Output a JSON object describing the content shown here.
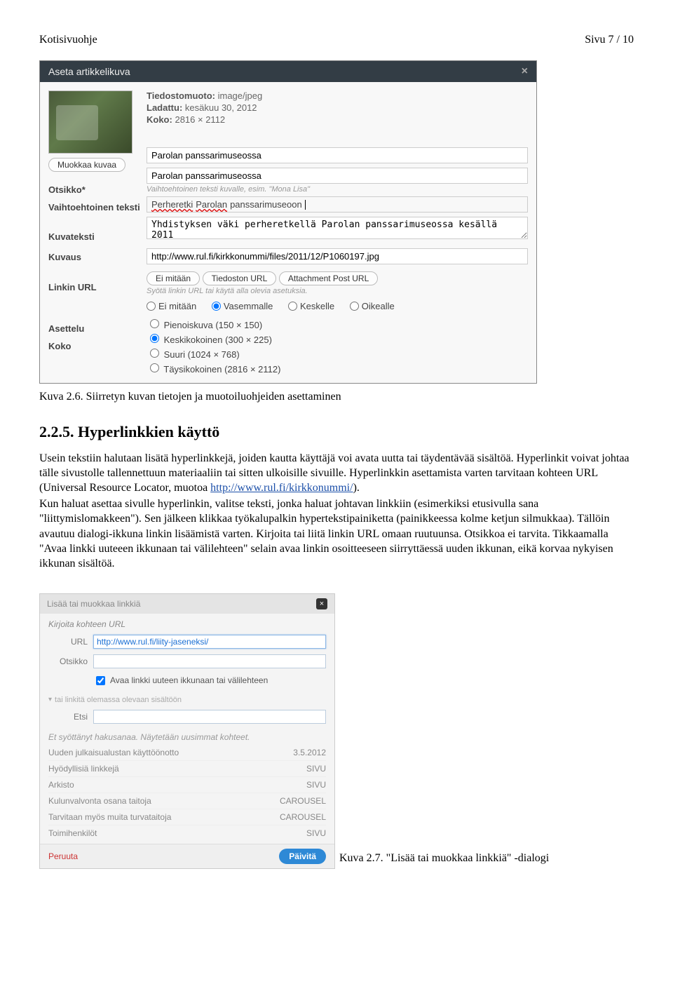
{
  "header": {
    "left": "Kotisivuohje",
    "right": "Sivu 7 / 10"
  },
  "modal1": {
    "title": "Aseta artikkelikuva",
    "edit_button": "Muokkaa kuvaa",
    "meta": {
      "format_label": "Tiedostomuoto:",
      "format_value": "image/jpeg",
      "loaded_label": "Ladattu:",
      "loaded_value": "kesäkuu 30, 2012",
      "size_label": "Koko:",
      "size_value": "2816 × 2112"
    },
    "fields": {
      "title_label": "Otsikko",
      "title_value": "Parolan panssarimuseossa",
      "alt_label": "Vaihtoehtoinen teksti",
      "alt_value": "Parolan panssarimuseossa",
      "alt_hint": "Vaihtoehtoinen teksti kuvalle, esim. \"Mona Lisa\"",
      "caption_label": "Kuvateksti",
      "caption_prefix": "Perheretki",
      "caption_word": "Parolan",
      "caption_suffix": " panssarimuseoon",
      "desc_label": "Kuvaus",
      "desc_value": "Yhdistyksen väki perheretkellä Parolan panssarimuseossa kesällä 2011",
      "linkurl_label": "Linkin URL",
      "linkurl_value": "http://www.rul.fi/kirkkonummi/files/2011/12/P1060197.jpg",
      "linkurl_btn1": "Ei mitään",
      "linkurl_btn2": "Tiedoston URL",
      "linkurl_btn3": "Attachment Post URL",
      "linkurl_hint": "Syötä linkin URL tai käytä alla olevia asetuksia.",
      "align_label": "Asettelu",
      "align_none": "Ei mitään",
      "align_left": "Vasemmalle",
      "align_center": "Keskelle",
      "align_right": "Oikealle",
      "sizegroup_label": "Koko",
      "size_thumb": "Pienoiskuva  (150 × 150)",
      "size_medium": "Keskikokoinen  (300 × 225)",
      "size_large": "Suuri  (1024 × 768)",
      "size_full": "Täysikokoinen  (2816 × 2112)"
    }
  },
  "caption1": "Kuva 2.6. Siirretyn kuvan tietojen ja muotoiluohjeiden asettaminen",
  "section225": {
    "heading": "2.2.5. Hyperlinkkien käyttö",
    "p1a": "Usein tekstiin halutaan lisätä hyperlinkkejä, joiden kautta käyttäjä voi avata uutta tai täydentävää sisältöä. Hyperlinkit voivat johtaa tälle sivustolle tallennettuun materiaaliin tai sitten ulkoisille sivuille. Hyperlinkkin asettamista varten tarvitaan kohteen URL (Universal Resource Locator, muotoa ",
    "p1_link": "http://www.rul.fi/kirkkonummi/",
    "p1b": ").",
    "p2": "Kun haluat asettaa sivulle hyperlinkin, valitse teksti, jonka haluat johtavan linkkiin (esimerkiksi etusivulla sana \"liittymislomakkeen\"). Sen jälkeen klikkaa työkalupalkin hypertekstipainiketta (painikkeessa kolme ketjun silmukkaa). Tällöin avautuu dialogi-ikkuna linkin lisäämistä varten. Kirjoita tai liitä linkin URL omaan ruutuunsa.  Otsikkoa ei tarvita. Tikkaamalla \"Avaa linkki uuteeen ikkunaan tai välilehteen\" selain avaa linkin osoitteeseen siirryttäessä uuden ikkunan, eikä korvaa nykyisen ikkunan sisältöä."
  },
  "dialog2": {
    "title": "Lisää tai muokkaa linkkiä",
    "sec1": "Kirjoita kohteen URL",
    "url_label": "URL",
    "url_value": "http://www.rul.fi/liity-jaseneksi/",
    "title_label": "Otsikko",
    "title_value": "",
    "checkbox_label": "Avaa linkki uuteen ikkunaan tai välilehteen",
    "toggle": "tai linkitä olemassa olevaan sisältöön",
    "search_label": "Etsi",
    "search_value": "",
    "note": "Et syöttänyt hakusanaa. Näytetään uusimmat kohteet.",
    "rows": [
      {
        "t": "Uuden julkaisualustan käyttöönotto",
        "r": "3.5.2012"
      },
      {
        "t": "Hyödyllisiä linkkejä",
        "r": "SIVU"
      },
      {
        "t": "Arkisto",
        "r": "SIVU"
      },
      {
        "t": "Kulunvalvonta osana taitoja",
        "r": "CAROUSEL"
      },
      {
        "t": "Tarvitaan myös muita turvataitoja",
        "r": "CAROUSEL"
      },
      {
        "t": "Toimihenkilöt",
        "r": "SIVU"
      }
    ],
    "cancel": "Peruuta",
    "submit": "Päivitä"
  },
  "caption2": "Kuva 2.7. \"Lisää tai muokkaa linkkiä\" -dialogi"
}
